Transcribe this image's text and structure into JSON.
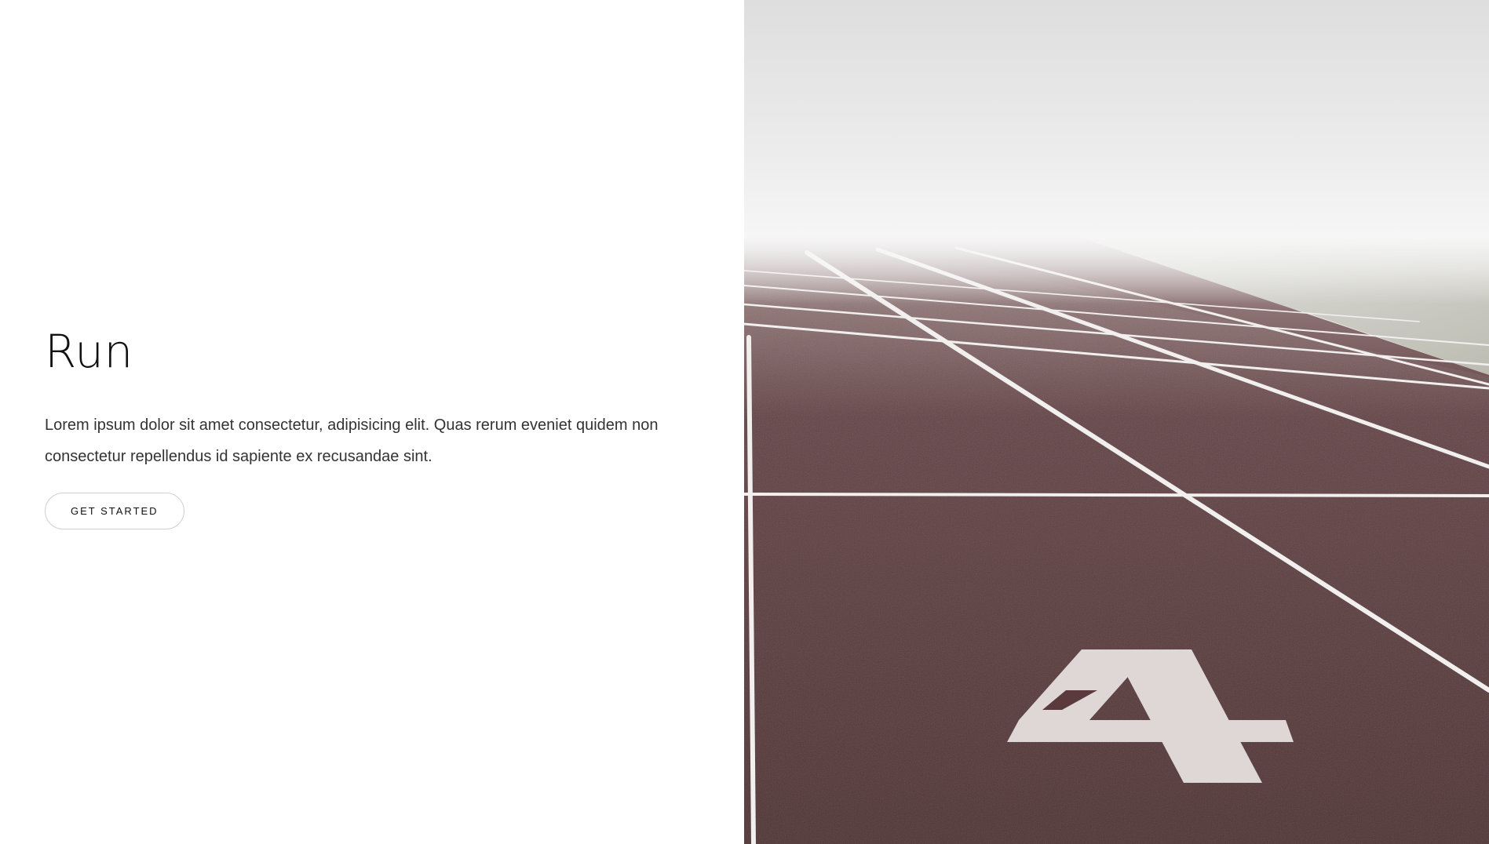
{
  "hero": {
    "title": "Run",
    "description": "Lorem ipsum dolor sit amet consectetur, adipisicing elit. Quas rerum eveniet quidem non consectetur repellendus id sapiente ex recusandae sint.",
    "cta_label": "GET STARTED"
  },
  "image": {
    "subject": "running track in fog",
    "lane_number": "4"
  },
  "colors": {
    "track": "#5a3a3c",
    "lines": "#f2f0ef",
    "fog": "#f1f1f1",
    "button_border": "#cfcfcf"
  }
}
